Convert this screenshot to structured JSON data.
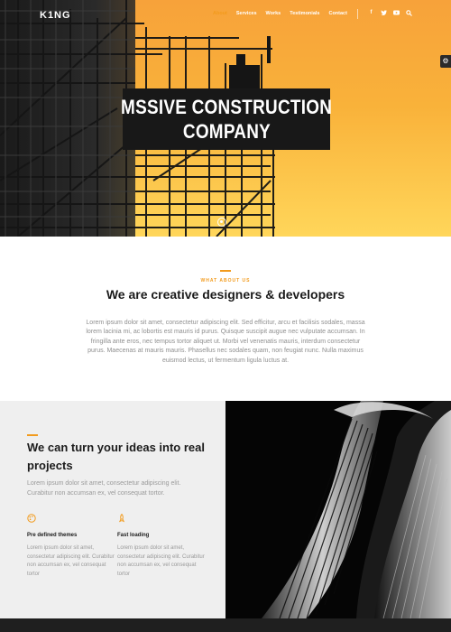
{
  "nav": {
    "logo": "K1NG",
    "links": [
      "About",
      "Services",
      "Works",
      "Testimonials",
      "Contact"
    ],
    "social_icons": [
      "facebook-icon",
      "twitter-icon",
      "youtube-icon",
      "search-icon"
    ]
  },
  "hero": {
    "title_line1": "MSSIVE CONSTRUCTION",
    "title_line2": "COMPANY"
  },
  "about": {
    "kicker": "WHAT ABOUT US",
    "heading": "We are creative designers & developers",
    "text": "Lorem ipsum dolor sit amet, consectetur adipiscing elit. Sed efficitur, arcu et facilisis sodales, massa lorem lacinia mi, ac lobortis est mauris id purus. Quisque suscipit augue nec vulputate accumsan. In fringilla ante eros, nec tempus tortor aliquet ut. Morbi vel venenatis mauris, interdum consectetur purus. Maecenas at mauris mauris. Phasellus nec sodales quam, non feugiat nunc. Nulla maximus euismod lectus, ut fermentum ligula luctus at."
  },
  "features": {
    "heading": "We can turn your ideas into real projects",
    "text": "Lorem ipsum dolor sit amet, consectetur adipiscing elit. Curabitur non accumsan ex, vel consequat tortor.",
    "items": [
      {
        "icon": "palette-icon",
        "title": "Pre defined themes",
        "desc": "Lorem ipsum dolor sit amet, consectetur adipiscing elit. Curabitur non accumsan ex, vel consequat tortor"
      },
      {
        "icon": "rocket-icon",
        "title": "Fast loading",
        "desc": "Lorem ipsum dolor sit amet, consectetur adipiscing elit. Curabitur non accumsan ex, vel consequat tortor"
      }
    ]
  },
  "colors": {
    "accent": "#f29b1d",
    "dark": "#181818",
    "muted_text": "#9a9a9a"
  }
}
